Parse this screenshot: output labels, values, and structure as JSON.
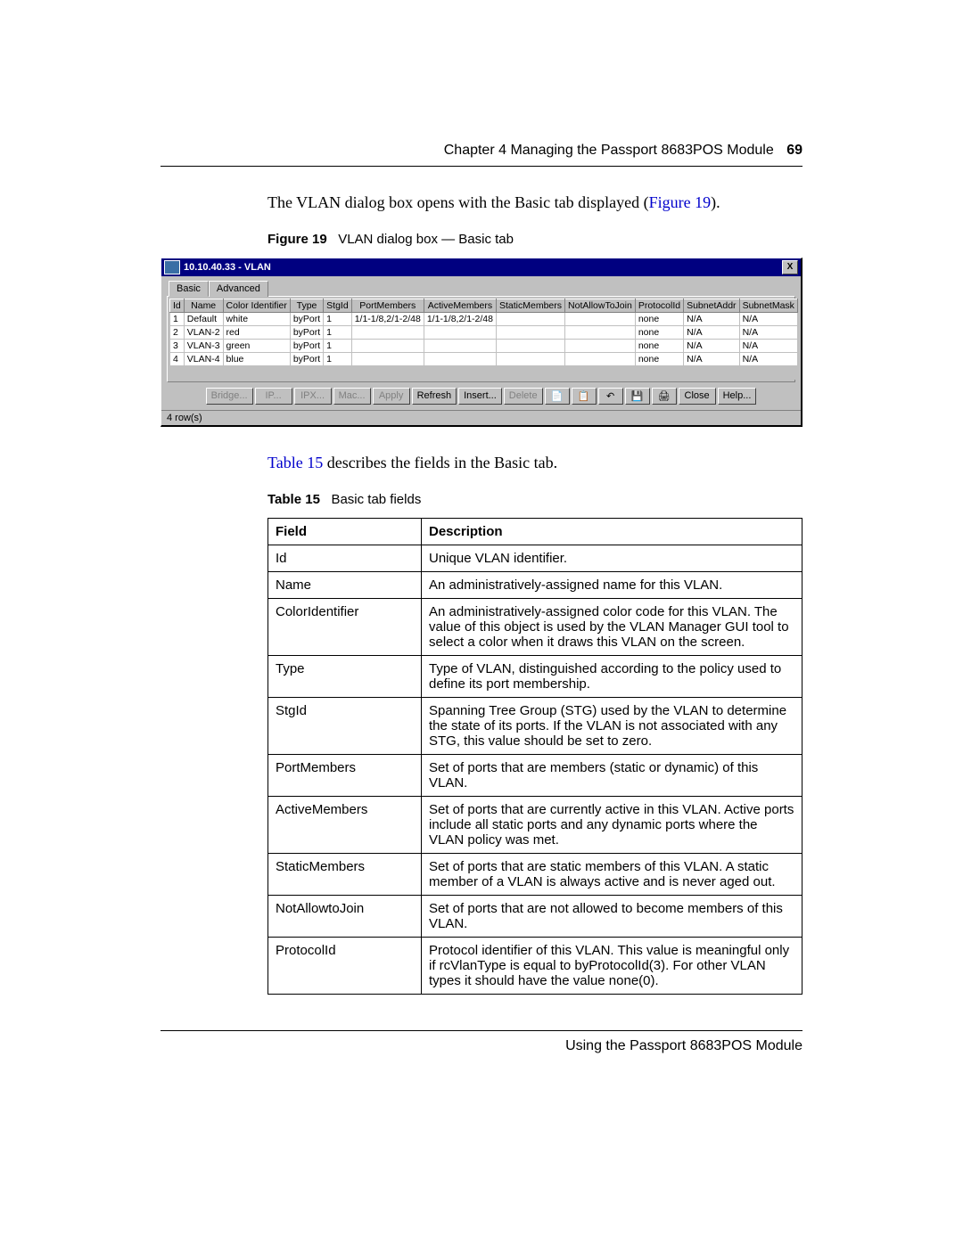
{
  "header": {
    "chapter": "Chapter 4  Managing the Passport 8683POS Module",
    "page": "69"
  },
  "intro": {
    "prefix": "The VLAN dialog box opens with the Basic tab displayed (",
    "link": "Figure 19",
    "suffix": ")."
  },
  "figcap": {
    "label": "Figure 19",
    "title": "VLAN dialog box — Basic tab"
  },
  "dialog": {
    "title": "10.10.40.33 - VLAN",
    "close": "X",
    "tabs": [
      "Basic",
      "Advanced"
    ],
    "columns": [
      "Id",
      "Name",
      "Color Identifier",
      "Type",
      "StgId",
      "PortMembers",
      "ActiveMembers",
      "StaticMembers",
      "NotAllowToJoin",
      "ProtocolId",
      "SubnetAddr",
      "SubnetMask"
    ],
    "rows": [
      {
        "Id": "1",
        "Name": "Default",
        "Color": "white",
        "Type": "byPort",
        "StgId": "1",
        "PortMembers": "1/1-1/8,2/1-2/48",
        "ActiveMembers": "1/1-1/8,2/1-2/48",
        "StaticMembers": "",
        "NotAllowToJoin": "",
        "ProtocolId": "none",
        "SubnetAddr": "N/A",
        "SubnetMask": "N/A"
      },
      {
        "Id": "2",
        "Name": "VLAN-2",
        "Color": "red",
        "Type": "byPort",
        "StgId": "1",
        "PortMembers": "",
        "ActiveMembers": "",
        "StaticMembers": "",
        "NotAllowToJoin": "",
        "ProtocolId": "none",
        "SubnetAddr": "N/A",
        "SubnetMask": "N/A"
      },
      {
        "Id": "3",
        "Name": "VLAN-3",
        "Color": "green",
        "Type": "byPort",
        "StgId": "1",
        "PortMembers": "",
        "ActiveMembers": "",
        "StaticMembers": "",
        "NotAllowToJoin": "",
        "ProtocolId": "none",
        "SubnetAddr": "N/A",
        "SubnetMask": "N/A"
      },
      {
        "Id": "4",
        "Name": "VLAN-4",
        "Color": "blue",
        "Type": "byPort",
        "StgId": "1",
        "PortMembers": "",
        "ActiveMembers": "",
        "StaticMembers": "",
        "NotAllowToJoin": "",
        "ProtocolId": "none",
        "SubnetAddr": "N/A",
        "SubnetMask": "N/A"
      }
    ],
    "buttons": {
      "disabled": [
        "Bridge...",
        "IP...",
        "IPX...",
        "Mac...",
        "Apply"
      ],
      "enabled": [
        "Refresh",
        "Insert..."
      ],
      "disabled2": [
        "Delete"
      ],
      "icons": [
        "copy-icon",
        "paste-icon",
        "undo-icon",
        "save-icon",
        "print-icon"
      ],
      "enabled2": [
        "Close",
        "Help..."
      ]
    },
    "status": "4 row(s)"
  },
  "midtext": {
    "link": "Table 15",
    "rest": " describes the fields in the Basic tab."
  },
  "tblcap": {
    "label": "Table 15",
    "title": "Basic tab fields"
  },
  "fields": {
    "headers": [
      "Field",
      "Description"
    ],
    "rows": [
      {
        "f": "Id",
        "d": "Unique VLAN identifier."
      },
      {
        "f": "Name",
        "d": "An administratively-assigned name for this VLAN."
      },
      {
        "f": "ColorIdentifier",
        "d": "An administratively-assigned color code for this VLAN. The value of this object is used by the VLAN Manager GUI tool to select a color when it draws this VLAN on the screen."
      },
      {
        "f": "Type",
        "d": "Type of VLAN, distinguished according to the policy used to define its port membership."
      },
      {
        "f": "StgId",
        "d": "Spanning Tree Group (STG) used by the VLAN to determine the state of its ports. If the VLAN is not associated with any STG, this value should be set to zero."
      },
      {
        "f": "PortMembers",
        "d": "Set of ports that are members (static or dynamic) of this VLAN."
      },
      {
        "f": "ActiveMembers",
        "d": "Set of ports that are currently active in this VLAN. Active ports include all static ports and any dynamic ports where the VLAN policy was met."
      },
      {
        "f": "StaticMembers",
        "d": "Set of ports that are static members of this VLAN. A static member of a VLAN is always active and is never aged out."
      },
      {
        "f": "NotAllowtoJoin",
        "d": "Set of ports that are not allowed to become members of this VLAN."
      },
      {
        "f": "ProtocolId",
        "d": "Protocol identifier of this VLAN. This value is meaningful only if rcVlanType is equal to byProtocolId(3). For other VLAN types it should have the value none(0)."
      }
    ]
  },
  "footer": "Using the Passport 8683POS Module"
}
